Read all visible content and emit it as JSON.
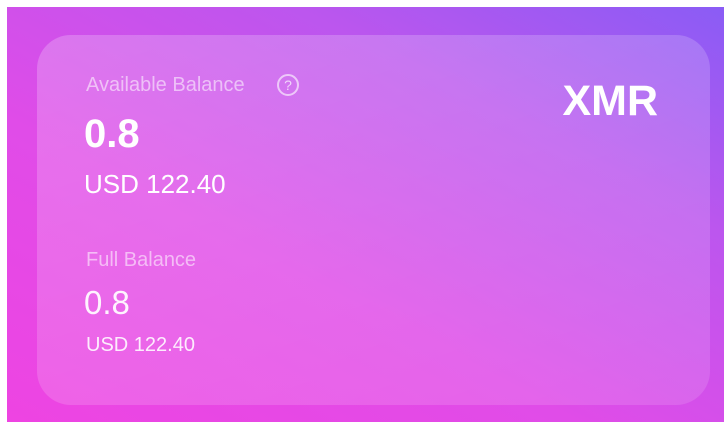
{
  "wallet_card": {
    "currency": "XMR",
    "available_balance": {
      "label": "Available Balance",
      "help_icon": "question-circle-icon",
      "help_glyph": "?",
      "amount": "0.8",
      "fiat": "USD 122.40"
    },
    "full_balance": {
      "label": "Full Balance",
      "amount": "0.8",
      "fiat": "USD 122.40"
    }
  },
  "colors": {
    "background_top_right": "#8a5cf5",
    "background_bottom_left": "#ee44e2",
    "text": "#ffffff"
  }
}
